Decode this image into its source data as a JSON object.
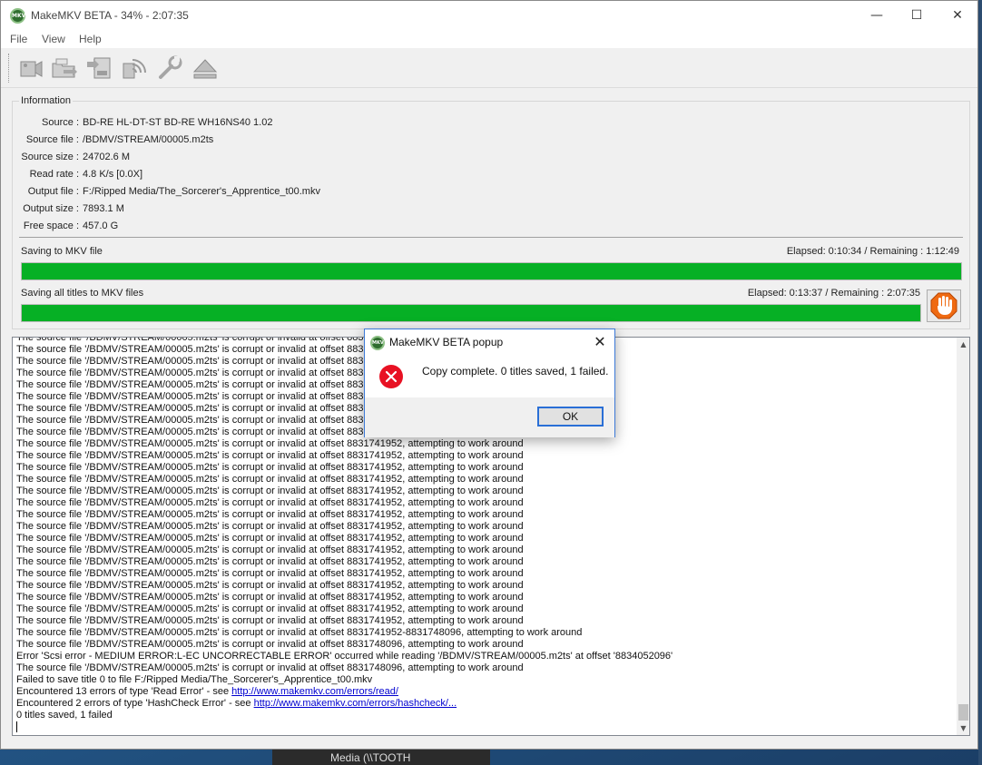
{
  "window": {
    "title": "MakeMKV BETA - 34% - 2:07:35",
    "app_icon_text": "MKV",
    "controls": {
      "minimize": "—",
      "maximize": "☐",
      "close": "✕"
    }
  },
  "menu": {
    "items": [
      "File",
      "View",
      "Help"
    ]
  },
  "toolbar": {
    "buttons": [
      "open-files-icon",
      "open-disc-icon",
      "backup-icon",
      "stream-icon",
      "preferences-icon",
      "eject-icon"
    ]
  },
  "info": {
    "group_title": "Information",
    "rows": [
      {
        "label": "Source :",
        "value": "BD-RE HL-DT-ST BD-RE  WH16NS40 1.02"
      },
      {
        "label": "Source file :",
        "value": "/BDMV/STREAM/00005.m2ts"
      },
      {
        "label": "Source size :",
        "value": "24702.6 M"
      },
      {
        "label": "Read rate :",
        "value": "4.8 K/s [0.0X]"
      },
      {
        "label": "Output file :",
        "value": "F:/Ripped Media/The_Sorcerer's_Apprentice_t00.mkv"
      },
      {
        "label": "Output size :",
        "value": "7893.1 M"
      },
      {
        "label": "Free space :",
        "value": "457.0 G"
      }
    ]
  },
  "progress": {
    "current": {
      "label": "Saving to MKV file",
      "times": "Elapsed: 0:10:34 / Remaining : 1:12:49",
      "fraction": 1.0
    },
    "total": {
      "label": "Saving all titles to MKV files",
      "times": "Elapsed: 0:13:37 / Remaining : 2:07:35",
      "fraction": 1.0
    },
    "fill_color": "#06b025"
  },
  "log": {
    "lines": [
      "The source file '/BDMV/STREAM/00005.m2ts' is corrupt or invalid at offset 8831741952, attempting to work around",
      "The source file '/BDMV/STREAM/00005.m2ts' is corrupt or invalid at offset 8831741952, attempting to work around",
      "The source file '/BDMV/STREAM/00005.m2ts' is corrupt or invalid at offset 8831741952, attempting to work around",
      "The source file '/BDMV/STREAM/00005.m2ts' is corrupt or invalid at offset 8831741952, attempting to work around",
      "The source file '/BDMV/STREAM/00005.m2ts' is corrupt or invalid at offset 8831741952, attempting to work around",
      "The source file '/BDMV/STREAM/00005.m2ts' is corrupt or invalid at offset 8831741952, attempting to work around",
      "The source file '/BDMV/STREAM/00005.m2ts' is corrupt or invalid at offset 8831741952, attempting to work around",
      "The source file '/BDMV/STREAM/00005.m2ts' is corrupt or invalid at offset 8831741952, attempting to work around",
      "The source file '/BDMV/STREAM/00005.m2ts' is corrupt or invalid at offset 8831741952, attempting to work around",
      "The source file '/BDMV/STREAM/00005.m2ts' is corrupt or invalid at offset 8831741952, attempting to work around",
      "The source file '/BDMV/STREAM/00005.m2ts' is corrupt or invalid at offset 8831741952, attempting to work around",
      "The source file '/BDMV/STREAM/00005.m2ts' is corrupt or invalid at offset 8831741952, attempting to work around",
      "The source file '/BDMV/STREAM/00005.m2ts' is corrupt or invalid at offset 8831741952, attempting to work around",
      "The source file '/BDMV/STREAM/00005.m2ts' is corrupt or invalid at offset 8831741952, attempting to work around",
      "The source file '/BDMV/STREAM/00005.m2ts' is corrupt or invalid at offset 8831741952, attempting to work around",
      "The source file '/BDMV/STREAM/00005.m2ts' is corrupt or invalid at offset 8831741952, attempting to work around",
      "The source file '/BDMV/STREAM/00005.m2ts' is corrupt or invalid at offset 8831741952, attempting to work around",
      "The source file '/BDMV/STREAM/00005.m2ts' is corrupt or invalid at offset 8831741952, attempting to work around",
      "The source file '/BDMV/STREAM/00005.m2ts' is corrupt or invalid at offset 8831741952, attempting to work around",
      "The source file '/BDMV/STREAM/00005.m2ts' is corrupt or invalid at offset 8831741952, attempting to work around",
      "The source file '/BDMV/STREAM/00005.m2ts' is corrupt or invalid at offset 8831741952, attempting to work around",
      "The source file '/BDMV/STREAM/00005.m2ts' is corrupt or invalid at offset 8831741952, attempting to work around",
      "The source file '/BDMV/STREAM/00005.m2ts' is corrupt or invalid at offset 8831741952, attempting to work around",
      "The source file '/BDMV/STREAM/00005.m2ts' is corrupt or invalid at offset 8831741952, attempting to work around",
      "The source file '/BDMV/STREAM/00005.m2ts' is corrupt or invalid at offset 8831741952, attempting to work around",
      "The source file '/BDMV/STREAM/00005.m2ts' is corrupt or invalid at offset 8831741952-8831748096, attempting to work around",
      "The source file '/BDMV/STREAM/00005.m2ts' is corrupt or invalid at offset 8831748096, attempting to work around",
      "Error 'Scsi error - MEDIUM ERROR:L-EC UNCORRECTABLE ERROR' occurred while reading '/BDMV/STREAM/00005.m2ts' at offset '8834052096'",
      "The source file '/BDMV/STREAM/00005.m2ts' is corrupt or invalid at offset 8831748096, attempting to work around",
      "Failed to save title 0 to file F:/Ripped Media/The_Sorcerer's_Apprentice_t00.mkv"
    ],
    "link_lines": [
      {
        "prefix": "Encountered 13 errors of type 'Read Error' - see ",
        "link": "http://www.makemkv.com/errors/read/"
      },
      {
        "prefix": "Encountered 2 errors of type 'HashCheck Error' - see ",
        "link": "http://www.makemkv.com/errors/hashcheck/..."
      }
    ],
    "final_line": "0 titles saved, 1 failed",
    "scroll_up": "▲",
    "scroll_down": "▼"
  },
  "popup": {
    "title": "MakeMKV BETA popup",
    "icon_text": "MKV",
    "close": "✕",
    "message": "Copy complete. 0 titles saved, 1 failed.",
    "ok_label": "OK"
  },
  "taskbar": {
    "partial_text": "Media (\\\\TOOTH"
  }
}
